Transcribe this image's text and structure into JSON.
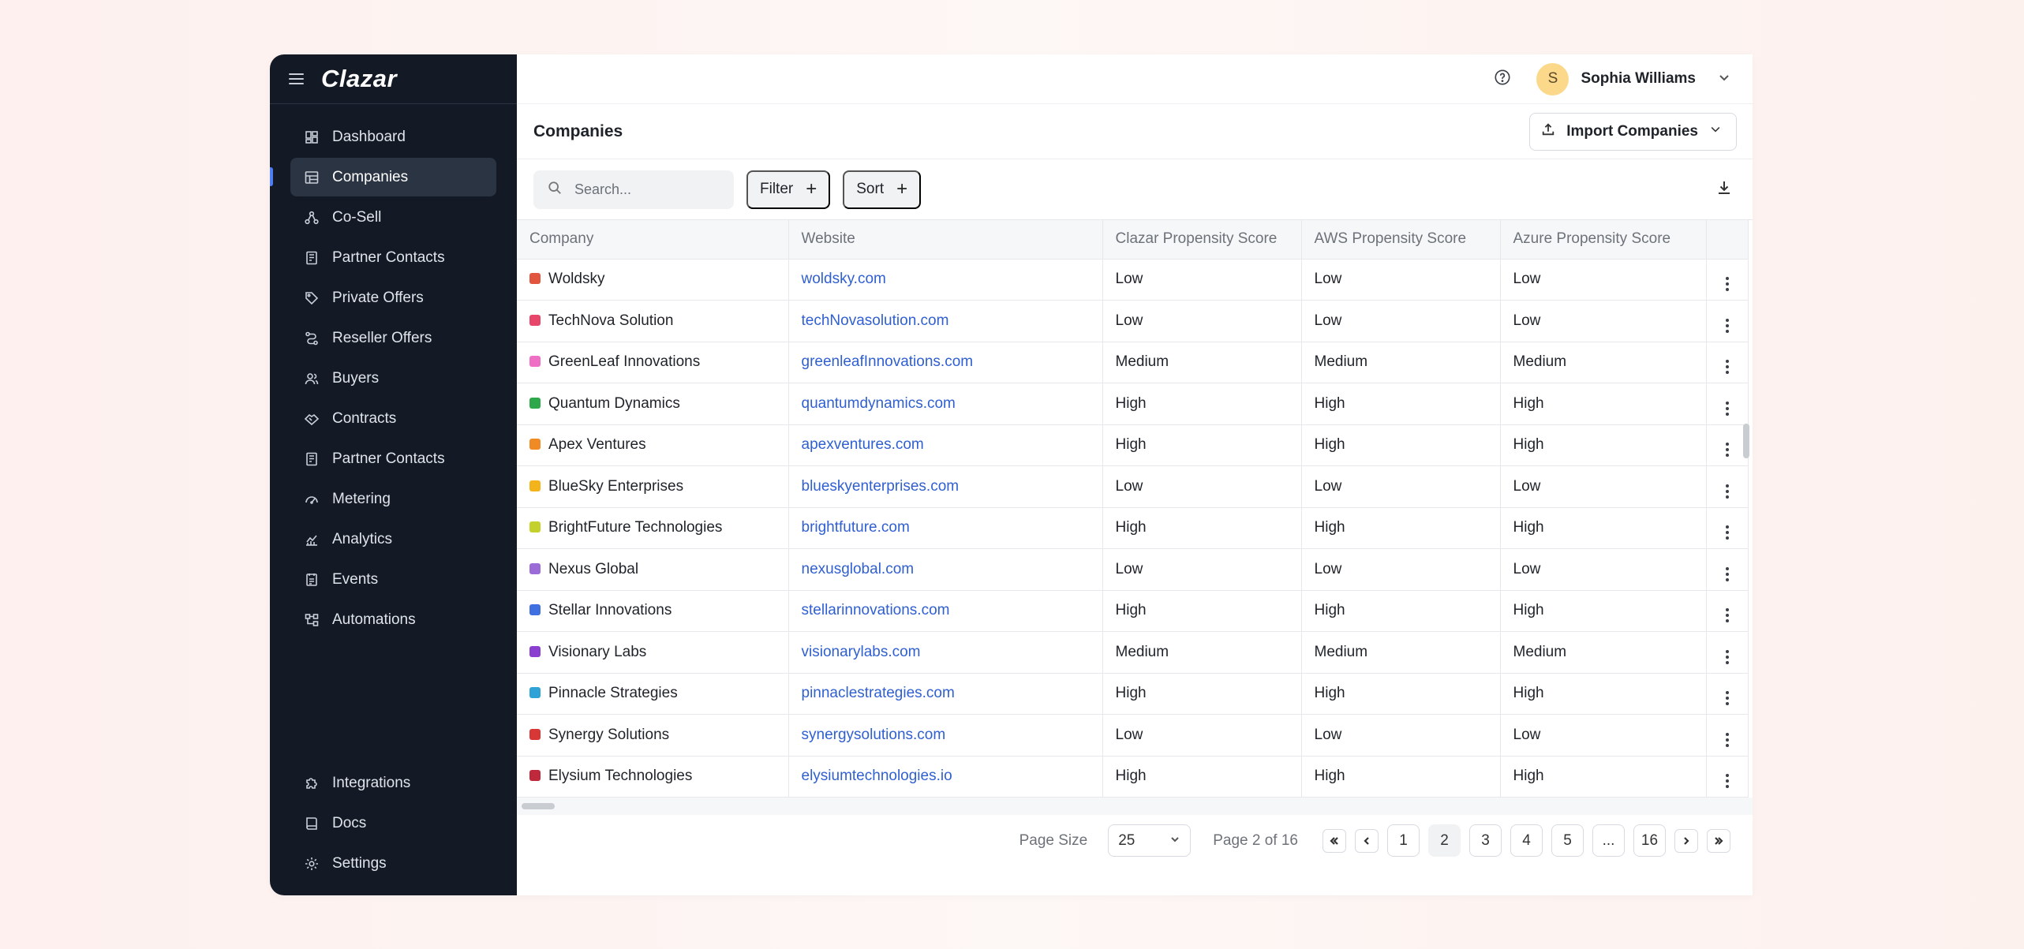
{
  "app": {
    "logo": "Clazar"
  },
  "header": {
    "user_initial": "S",
    "user_name": "Sophia Williams"
  },
  "sidebar": {
    "items": [
      {
        "label": "Dashboard",
        "icon": "dashboard-icon",
        "active": false
      },
      {
        "label": "Companies",
        "icon": "companies-icon",
        "active": true
      },
      {
        "label": "Co-Sell",
        "icon": "co-sell-icon",
        "active": false
      },
      {
        "label": "Partner Contacts",
        "icon": "partner-contacts-icon",
        "active": false
      },
      {
        "label": "Private Offers",
        "icon": "tag-icon",
        "active": false
      },
      {
        "label": "Reseller Offers",
        "icon": "route-icon",
        "active": false
      },
      {
        "label": "Buyers",
        "icon": "users-icon",
        "active": false
      },
      {
        "label": "Contracts",
        "icon": "handshake-icon",
        "active": false
      },
      {
        "label": "Partner Contacts",
        "icon": "partner-contacts-icon",
        "active": false
      },
      {
        "label": "Metering",
        "icon": "gauge-icon",
        "active": false
      },
      {
        "label": "Analytics",
        "icon": "analytics-icon",
        "active": false
      },
      {
        "label": "Events",
        "icon": "events-icon",
        "active": false
      },
      {
        "label": "Automations",
        "icon": "automations-icon",
        "active": false
      }
    ],
    "bottom_items": [
      {
        "label": "Integrations",
        "icon": "puzzle-icon"
      },
      {
        "label": "Docs",
        "icon": "book-icon"
      },
      {
        "label": "Settings",
        "icon": "gear-icon"
      }
    ]
  },
  "page": {
    "title": "Companies",
    "import_label": "Import Companies"
  },
  "toolbar": {
    "search_placeholder": "Search...",
    "filter_label": "Filter",
    "sort_label": "Sort"
  },
  "table": {
    "columns": [
      "Company",
      "Website",
      "Clazar Propensity Score",
      "AWS Propensity Score",
      "Azure Propensity Score"
    ],
    "rows": [
      {
        "company": "Woldsky",
        "website": "woldsky.com",
        "clazar": "Low",
        "aws": "Low",
        "azure": "Low",
        "logo_color": "#e2553f"
      },
      {
        "company": "TechNova Solution",
        "website": "techNovasolution.com",
        "clazar": "Low",
        "aws": "Low",
        "azure": "Low",
        "logo_color": "#e8456b"
      },
      {
        "company": "GreenLeaf Innovations",
        "website": "greenleafInnovations.com",
        "clazar": "Medium",
        "aws": "Medium",
        "azure": "Medium",
        "logo_color": "#ef6fc4"
      },
      {
        "company": "Quantum Dynamics",
        "website": "quantumdynamics.com",
        "clazar": "High",
        "aws": "High",
        "azure": "High",
        "logo_color": "#2ea84a"
      },
      {
        "company": "Apex Ventures",
        "website": "apexventures.com",
        "clazar": "High",
        "aws": "High",
        "azure": "High",
        "logo_color": "#f08a24"
      },
      {
        "company": "BlueSky Enterprises",
        "website": "blueskyenterprises.com",
        "clazar": "Low",
        "aws": "Low",
        "azure": "Low",
        "logo_color": "#f3b41b"
      },
      {
        "company": "BrightFuture Technologies",
        "website": "brightfuture.com",
        "clazar": "High",
        "aws": "High",
        "azure": "High",
        "logo_color": "#c4d12c"
      },
      {
        "company": "Nexus Global",
        "website": "nexusglobal.com",
        "clazar": "Low",
        "aws": "Low",
        "azure": "Low",
        "logo_color": "#9b6bd8"
      },
      {
        "company": "Stellar Innovations",
        "website": "stellarinnovations.com",
        "clazar": "High",
        "aws": "High",
        "azure": "High",
        "logo_color": "#3f6fe0"
      },
      {
        "company": "Visionary Labs",
        "website": "visionarylabs.com",
        "clazar": "Medium",
        "aws": "Medium",
        "azure": "Medium",
        "logo_color": "#8a3fd1"
      },
      {
        "company": "Pinnacle Strategies",
        "website": "pinnaclestrategies.com",
        "clazar": "High",
        "aws": "High",
        "azure": "High",
        "logo_color": "#2fa3d6"
      },
      {
        "company": "Synergy Solutions",
        "website": "synergysolutions.com",
        "clazar": "Low",
        "aws": "Low",
        "azure": "Low",
        "logo_color": "#d93636"
      },
      {
        "company": "Elysium Technologies",
        "website": "elysiumtechnologies.io",
        "clazar": "High",
        "aws": "High",
        "azure": "High",
        "logo_color": "#c0283b"
      }
    ]
  },
  "pagination": {
    "page_size_label": "Page Size",
    "page_size": "25",
    "page_info": "Page 2 of 16",
    "pages": [
      "1",
      "2",
      "3",
      "4",
      "5",
      "...",
      "16"
    ],
    "current": "2"
  },
  "colors": {
    "sidebar_bg": "#131a26",
    "accent": "#4f7df3",
    "link": "#2f5fd0"
  }
}
